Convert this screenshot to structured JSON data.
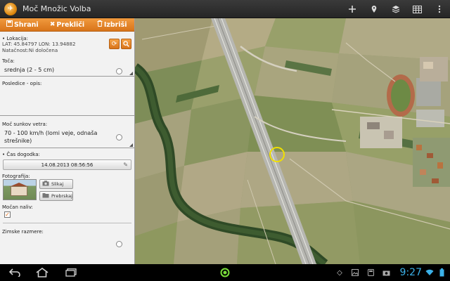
{
  "app": {
    "title": "Moč Množic Volba",
    "icon": "app-logo-icon",
    "actions": [
      "plus-icon",
      "location-pin-icon",
      "layers-icon",
      "grid-icon",
      "overflow-menu-icon"
    ]
  },
  "toolbar": {
    "save_label": "Shrani",
    "cancel_label": "Prekliči",
    "delete_label": "Izbriši"
  },
  "location": {
    "label": "• Lokacija:",
    "coords": "LAT: 45.84797 LON: 13.94882",
    "accuracy": "Natačnost:Ni določena"
  },
  "toca": {
    "label": "Toča:",
    "value": "srednja (2 - 5 cm)"
  },
  "posledice": {
    "label": "Posledice - opis:",
    "value": ""
  },
  "wind": {
    "label": "Moč sunkov vetra:",
    "value": "70 - 100 km/h (lomi veje, odnaša strešnike)"
  },
  "event_time": {
    "label": "• Čas dogodka:",
    "value": "14.08.2013 08:56:56"
  },
  "photo": {
    "label": "Fotografija:",
    "camera_button": "Slikaj",
    "browse_button": "Prebrskaj"
  },
  "heavy_rain": {
    "label": "Močan naliv:",
    "checked": true
  },
  "winter": {
    "label": "Zimske razmere:"
  },
  "system": {
    "time": "9:27"
  },
  "colors": {
    "accent": "#e8851f",
    "marker": "#f0e000",
    "clock": "#3bb1e8"
  }
}
